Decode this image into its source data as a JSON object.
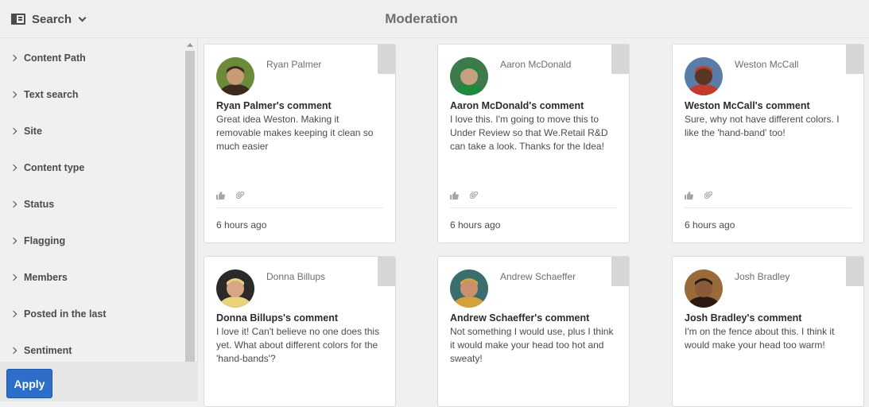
{
  "header": {
    "search_label": "Search",
    "title": "Moderation"
  },
  "sidebar": {
    "facets": [
      "Content Path",
      "Text search",
      "Site",
      "Content type",
      "Status",
      "Flagging",
      "Members",
      "Posted in the last",
      "Sentiment"
    ],
    "apply_label": "Apply"
  },
  "cards": [
    {
      "author": "Ryan Palmer",
      "title": "Ryan Palmer's comment",
      "body": "Great idea Weston. Making it removable makes keeping it clean so much easier",
      "time": "6 hours ago",
      "avatar_colors": [
        "#6b8a3a",
        "#3d2a1e",
        "#c99a76"
      ]
    },
    {
      "author": "Aaron McDonald",
      "title": "Aaron McDonald's comment",
      "body": "I love this. I'm going to move this to Under Review so that We.Retail R&D can take a look. Thanks for the Idea!",
      "time": "6 hours ago",
      "avatar_colors": [
        "#3f7a4f",
        "#1f8a3c",
        "#c7a07f"
      ]
    },
    {
      "author": "Weston McCall",
      "title": "Weston McCall's comment",
      "body": "Sure, why not have different colors. I like the 'hand-band' too!",
      "time": "6 hours ago",
      "avatar_colors": [
        "#5a7da8",
        "#c23b2d",
        "#5a3624"
      ]
    },
    {
      "author": "Donna Billups",
      "title": "Donna Billups's comment",
      "body": "I love it! Can't believe no one does this yet. What about different colors for the 'hand-bands'?",
      "time": "",
      "avatar_colors": [
        "#2a2a2a",
        "#e8d27a",
        "#d8a585"
      ]
    },
    {
      "author": "Andrew Schaeffer",
      "title": "Andrew Schaeffer's comment",
      "body": "Not something I would use, plus I think it would make your head too hot and sweaty!",
      "time": "",
      "avatar_colors": [
        "#3a6e6e",
        "#d6a13a",
        "#c99070"
      ]
    },
    {
      "author": "Josh Bradley",
      "title": "Josh Bradley's comment",
      "body": "I'm on the fence about this. I think it would make your head too warm!",
      "time": "",
      "avatar_colors": [
        "#9a6a3a",
        "#2a1a12",
        "#8a5a3a"
      ]
    }
  ]
}
